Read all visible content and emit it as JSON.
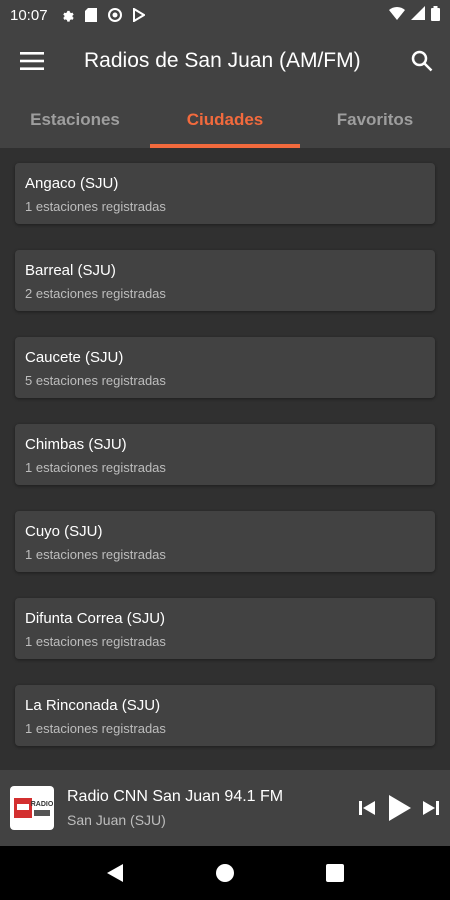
{
  "status_bar": {
    "time": "10:07",
    "icons": [
      "gear-icon",
      "sd-card-icon",
      "vpn-icon",
      "play-store-icon"
    ],
    "right_icons": [
      "wifi-icon",
      "signal-icon",
      "battery-icon"
    ]
  },
  "appbar": {
    "title": "Radios de San Juan (AM/FM)"
  },
  "tabs": [
    {
      "label": "Estaciones"
    },
    {
      "label": "Ciudades"
    },
    {
      "label": "Favoritos"
    }
  ],
  "active_tab": "Ciudades",
  "cities": [
    {
      "name": "Angaco (SJU)",
      "sub": "1 estaciones registradas"
    },
    {
      "name": "Barreal (SJU)",
      "sub": "2 estaciones registradas"
    },
    {
      "name": "Caucete (SJU)",
      "sub": "5 estaciones registradas"
    },
    {
      "name": "Chimbas (SJU)",
      "sub": "1 estaciones registradas"
    },
    {
      "name": "Cuyo (SJU)",
      "sub": "1 estaciones registradas"
    },
    {
      "name": "Difunta Correa (SJU)",
      "sub": "1 estaciones registradas"
    },
    {
      "name": "La Rinconada (SJU)",
      "sub": "1 estaciones registradas"
    }
  ],
  "player": {
    "title": "Radio CNN San Juan 94.1 FM",
    "subtitle": "San Juan (SJU)",
    "logo_text": "RADIO"
  },
  "colors": {
    "accent": "#f26a3d",
    "bar": "#424242",
    "background": "#303030"
  }
}
